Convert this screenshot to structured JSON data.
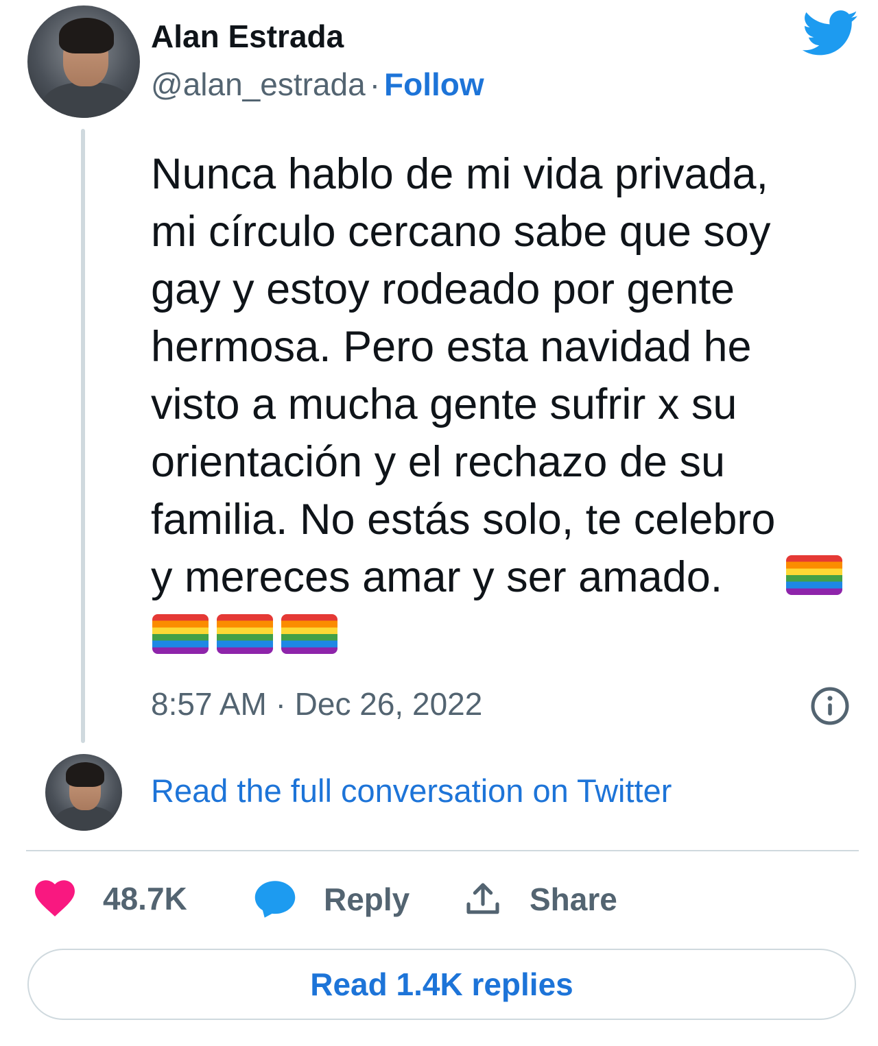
{
  "author": {
    "name": "Alan Estrada",
    "handle": "@alan_estrada",
    "separator": "·",
    "follow_label": "Follow"
  },
  "tweet": {
    "text": "Nunca hablo de mi vida privada,\nmi círculo cercano sabe que soy\ngay y estoy rodeado por gente\nhermosa. Pero esta navidad he\nvisto a mucha gente sufrir x su\norientación y el rechazo de su\nfamilia. No estás solo, te celebro\ny mereces amar y ser amado.",
    "time": "8:57 AM",
    "date_separator": "·",
    "date": "Dec 26, 2022"
  },
  "conversation_link": "Read the full conversation on Twitter",
  "actions": {
    "likes": "48.7K",
    "reply_label": "Reply",
    "share_label": "Share"
  },
  "read_replies_label": "Read 1.4K replies",
  "colors": {
    "link_blue": "#1d74d8",
    "twitter_blue": "#1d9bf0",
    "like_pink": "#f91880",
    "muted_gray": "#536471",
    "divider": "#cfd9de"
  },
  "icons": {
    "logo": "twitter-bird-icon",
    "info": "info-icon",
    "like": "heart-icon",
    "reply": "speech-bubble-icon",
    "share": "share-upload-icon",
    "emoji": "rainbow-flag-icon"
  }
}
